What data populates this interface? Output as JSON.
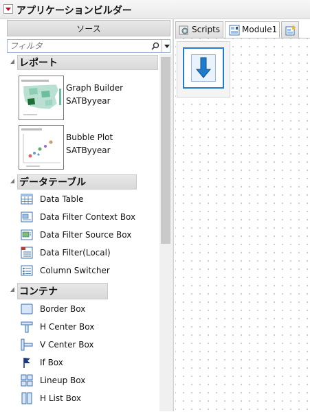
{
  "window": {
    "title": "アプリケーションビルダー"
  },
  "sources": {
    "header": "ソース",
    "filter_placeholder": "フィルタ",
    "sections": [
      {
        "title": "レポート",
        "items": [
          {
            "label": "Graph Builder",
            "sublabel": "SATByyear",
            "icon": "map-chart-thumbnail"
          },
          {
            "label": "Bubble Plot",
            "sublabel": "SATByyear",
            "icon": "bubble-plot-thumbnail"
          }
        ]
      },
      {
        "title": "データテーブル",
        "items": [
          {
            "label": "Data Table",
            "icon": "data-table-icon"
          },
          {
            "label": "Data Filter Context Box",
            "icon": "filter-context-icon"
          },
          {
            "label": "Data Filter Source Box",
            "icon": "filter-source-icon"
          },
          {
            "label": "Data Filter(Local)",
            "icon": "filter-local-icon"
          },
          {
            "label": "Column Switcher",
            "icon": "column-switcher-icon"
          }
        ]
      },
      {
        "title": "コンテナ",
        "items": [
          {
            "label": "Border Box",
            "icon": "border-box-icon"
          },
          {
            "label": "H Center Box",
            "icon": "h-center-box-icon"
          },
          {
            "label": "V Center Box",
            "icon": "v-center-box-icon"
          },
          {
            "label": "If Box",
            "icon": "flag-icon"
          },
          {
            "label": "Lineup Box",
            "icon": "lineup-box-icon"
          },
          {
            "label": "H List Box",
            "icon": "h-list-box-icon"
          }
        ]
      }
    ]
  },
  "tabs": [
    {
      "label": "Scripts",
      "icon": "scripts-icon",
      "active": false
    },
    {
      "label": "Module1",
      "icon": "module-icon",
      "active": true
    },
    {
      "label": "",
      "icon": "new-module-icon",
      "active": false
    }
  ],
  "colors": {
    "accent_blue": "#1e7ccc",
    "toggle_red": "#d0021b"
  }
}
